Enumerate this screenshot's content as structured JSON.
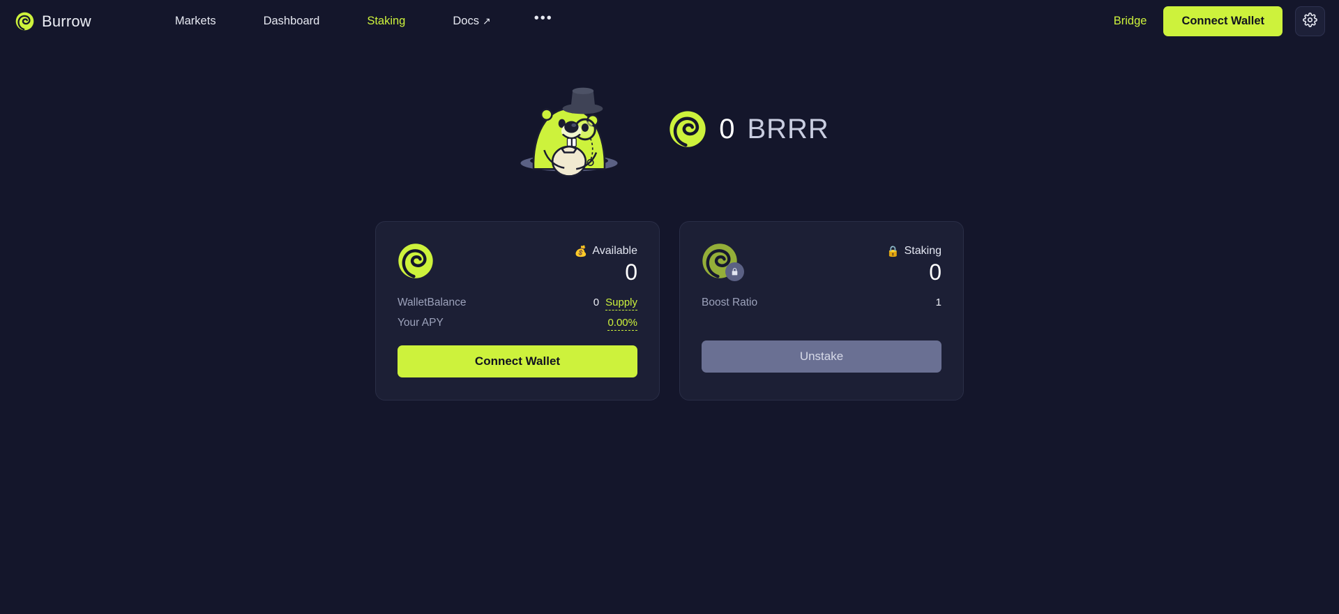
{
  "header": {
    "brand_name": "Burrow",
    "brand_logo_icon": "burrow-logo-icon",
    "nav": [
      {
        "label": "Markets",
        "active": false,
        "external": false
      },
      {
        "label": "Dashboard",
        "active": false,
        "external": false
      },
      {
        "label": "Staking",
        "active": true,
        "external": false
      },
      {
        "label": "Docs",
        "active": false,
        "external": true,
        "arrow": "↗"
      }
    ],
    "more_label": "•••",
    "bridge_label": "Bridge",
    "connect_wallet_label": "Connect Wallet",
    "settings_icon": "gear-icon"
  },
  "hero": {
    "mascot_icon": "burrow-beaver-mascot",
    "token_icon": "brrr-token-icon",
    "amount": "0",
    "symbol": "BRRR"
  },
  "cards": [
    {
      "id": "available",
      "icon": "brrr-token-icon",
      "badge_emoji": "💰",
      "label": "Available",
      "value": "0",
      "stats": [
        {
          "key": "WalletBalance",
          "value": "0",
          "link": "Supply"
        },
        {
          "key": "Your APY",
          "value": "",
          "link": "0.00%"
        }
      ],
      "button_label": "Connect Wallet",
      "button_style": "primary"
    },
    {
      "id": "staking",
      "icon": "brrr-token-locked-icon",
      "badge_emoji": "🔒",
      "label": "Staking",
      "value": "0",
      "stats": [
        {
          "key": "Boost Ratio",
          "value": "1",
          "link": ""
        }
      ],
      "button_label": "Unstake",
      "button_style": "muted"
    }
  ],
  "colors": {
    "accent_green": "#cdf23c",
    "background": "#14162b",
    "card_background": "#1c1f35",
    "muted_button": "#6a7093",
    "text_primary": "#eceef5",
    "text_muted": "#9ca2bb"
  }
}
